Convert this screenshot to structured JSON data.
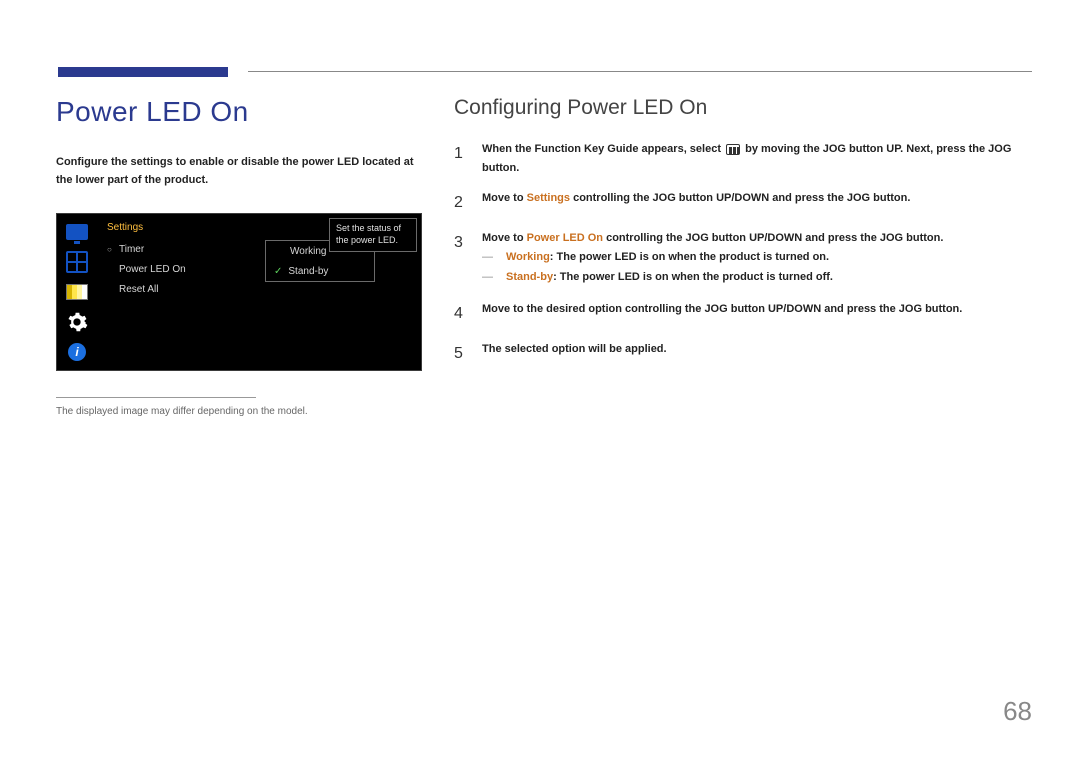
{
  "header": {},
  "left": {
    "title": "Power LED On",
    "intro": "Configure the settings to enable or disable the power LED located at the lower part of the product.",
    "osd": {
      "menu_title": "Settings",
      "items": [
        "Timer",
        "Power LED On",
        "Reset All"
      ],
      "options": [
        "Working",
        "Stand-by"
      ],
      "desc": "Set the status of the power LED."
    },
    "footnote": "The displayed image may differ depending on the model."
  },
  "right": {
    "title": "Configuring Power LED On",
    "steps": {
      "s1a": "When the Function Key Guide appears, select ",
      "s1b": " by moving the JOG button UP. Next, press the JOG button.",
      "s2a": "Move to ",
      "s2_hl": "Settings",
      "s2b": " controlling the JOG button UP/DOWN and press the JOG button.",
      "s3a": "Move to ",
      "s3_hl": "Power LED On",
      "s3b": " controlling the JOG button UP/DOWN and press the JOG button.",
      "note1_hl": "Working",
      "note1_rest": ": The power LED is on when the product is turned on.",
      "note2_hl": "Stand-by",
      "note2_rest": ": The power LED is on when the product is turned off.",
      "s4": "Move to the desired option controlling the JOG button UP/DOWN and press the JOG button.",
      "s5": "The selected option will be applied."
    },
    "nums": [
      "1",
      "2",
      "3",
      "4",
      "5"
    ],
    "dash": "―"
  },
  "page_number": "68"
}
